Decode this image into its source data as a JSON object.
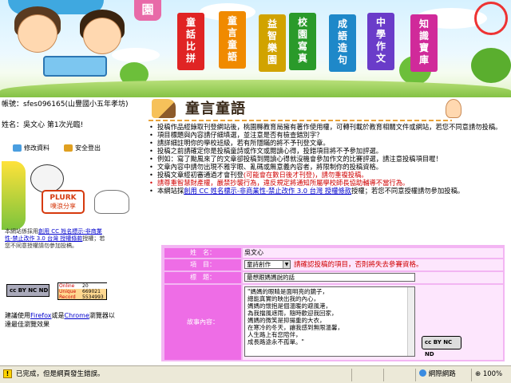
{
  "banner": {
    "categories": [
      "童話比拼",
      "童言童語",
      "益智樂園",
      "校園寫真",
      "成語造句",
      "中學作文",
      "知識寶庫"
    ],
    "corner_glyph": "園",
    "colors": [
      "#e02424",
      "#f08a00",
      "#d1a300",
      "#2a9a2a",
      "#1e88c9",
      "#6a3cc9",
      "#d02a9a"
    ]
  },
  "user": {
    "account_label": "帳號：",
    "account_value": "sfes096165(山豐國小五年孝坊)",
    "name_label": "姓名：",
    "name_value": "吳文心 第1次光臨!"
  },
  "user_buttons": {
    "edit": "修改資料",
    "logout": "安全登出"
  },
  "plurk": {
    "brand": "PLURK",
    "sub": "噗浪分享"
  },
  "license_note": {
    "prefix": "本網站係採用",
    "link": "創用 CC 姓名標示-非商業性-禁止改作 3.0 台灣 授權條款",
    "suffix": "授權；若您不同意授權請勿參加投稿。"
  },
  "counter": {
    "line1": "Online",
    "value1": "20",
    "line2": "Unique",
    "value2": "669021",
    "line3": "Record",
    "value3": "5534993"
  },
  "browser_note": {
    "prefix": "建議使用",
    "firefox": "Firefox",
    "mid": "或是",
    "chrome": "Chrome",
    "suffix": "瀏覽器以達最佳瀏覽效果"
  },
  "page": {
    "title": "童言童語",
    "rules": [
      {
        "text": "投稿作品經錄取刊登網站後，桃園縣教育局擁有著作使用權，可轉刊載於教育相關文件或網站，若您不同意請勿投稿。",
        "red": false
      },
      {
        "text": "項目標題與內容請仔細填選，並注意是否有檢查錯別字？",
        "red": false
      },
      {
        "text": "請詳細註明你的學校班級，若有所隱瞞的將不予刊登文章。",
        "red": false
      },
      {
        "text": "投稿之前請確定你是投稿童詩或作文或閱讀心得，投錯項目將不予參加評選。",
        "red": false
      },
      {
        "text": "例如：寫了颱風來了的文章卻投稿到閱讀心得就沒機會參加作文的比賽評選，請注意投稿項目喔！",
        "red": false
      },
      {
        "text": "文章內容中請勿出現不雅字眼、亂碼或無意義內容者，將限制你的投稿資格。",
        "red": false
      },
      {
        "text": "投稿文章經初審通過才會刊登(可能會在數日後才刊登)，請勿重複投稿。",
        "red": false,
        "red_part": "(可能會在數日後才刊登)，請勿重複投稿。"
      },
      {
        "text": "請尊重智慧財產權，嚴禁抄襲行為，違反規定將通知所屬學校師長協助輔導不當行為。",
        "red": true
      },
      {
        "text": "本網站採創用 CC 姓名標示-非商業性-禁止改作 3.0 台灣 授權條款授權；若您不同意授權請勿參加投稿。",
        "red": false
      }
    ]
  },
  "form": {
    "name_label": "姓　名：",
    "name_value": "吳文心",
    "item_label": "項　目：",
    "item_selected": "童詩創作",
    "item_warning": "請確認投稿的項目，否則將失去參賽資格。",
    "title_label": "標　題：",
    "title_value": "最想跟媽媽說的話",
    "content_label": "故事內容：",
    "content_lines": [
      "\"媽媽的眼睛是面明亮的鏡子，",
      "總能真實的映出我的內心，",
      "媽媽的懷抱是個溫暖的避風港，",
      "為我擋風遮雨，隨時歡迎我回家，",
      "媽媽的微笑是抑揚重的大衣，",
      "在寒冷的冬天，讓我感到無限溫馨，",
      "人生路上有您陪伴，",
      "成長路途永不孤單。\""
    ],
    "cc_text": "cc BY NC ND"
  },
  "statusbar": {
    "text": "已完成，但是網頁發生錯誤。",
    "zone": "網際網路",
    "zoom": "100%"
  }
}
